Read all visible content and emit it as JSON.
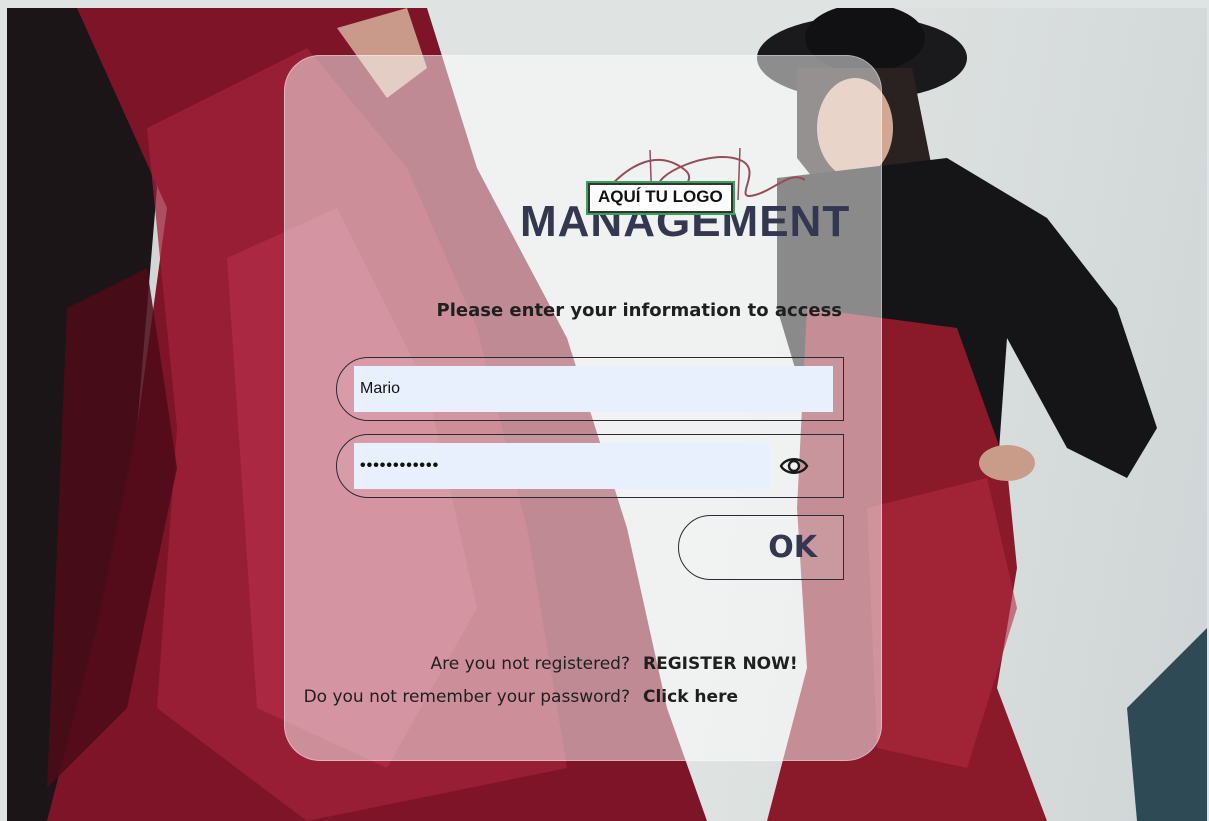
{
  "logo": {
    "wordmark": "MANAGEMENT",
    "badge": "AQUÍ TU LOGO"
  },
  "login": {
    "prompt": "Please enter your information to access",
    "username_value": "Mario",
    "password_value": "••••••••••••",
    "ok_label": "OK"
  },
  "help": {
    "register_question": "Are you not registered?",
    "register_link": "REGISTER NOW!",
    "forgot_question": "Do you not remember your password?",
    "forgot_link": "Click here"
  },
  "colors": {
    "brand": "#343750",
    "input_bg": "#e8f0fd",
    "dress_red": "#8c1830"
  },
  "icons": {
    "password_toggle": "eye-icon"
  }
}
